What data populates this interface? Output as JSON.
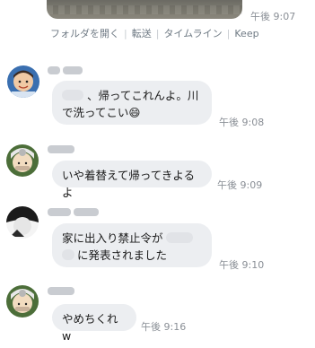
{
  "top": {
    "time": "午後 9:07",
    "actions": [
      "フォルダを開く",
      "転送",
      "タイムライン",
      "Keep"
    ]
  },
  "messages": [
    {
      "text_a": "、帰ってこれんよ。川",
      "text_b": "で洗ってこい",
      "emoji": "😄",
      "time": "午後 9:08"
    },
    {
      "text": "いや着替えて帰ってきよるよ",
      "time": "午後 9:09"
    },
    {
      "text_a": "家に出入り禁止令が",
      "text_b": "に発表されました",
      "time": "午後 9:10"
    },
    {
      "text": "やめちくれw",
      "time": "午後 9:16"
    }
  ],
  "colors": {
    "bubble": "#eceef1",
    "time": "#8a8f96",
    "actions": "#6f7a84"
  }
}
